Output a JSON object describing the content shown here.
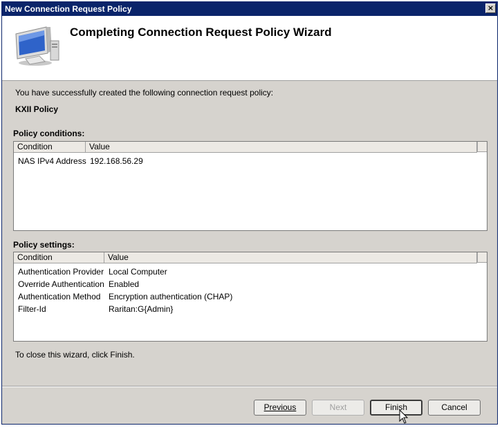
{
  "window": {
    "title": "New Connection Request Policy",
    "close_glyph": "×"
  },
  "header": {
    "title": "Completing Connection Request Policy Wizard",
    "icon": "computer-monitor-icon"
  },
  "intro_text": "You have successfully created the following connection request policy:",
  "policy_name": "KXII Policy",
  "conditions": {
    "label": "Policy conditions:",
    "columns": [
      "Condition",
      "Value"
    ],
    "rows": [
      {
        "condition": "NAS IPv4 Address",
        "value": "192.168.56.29"
      }
    ]
  },
  "settings": {
    "label": "Policy settings:",
    "columns": [
      "Condition",
      "Value"
    ],
    "rows": [
      {
        "condition": "Authentication Provider",
        "value": "Local Computer"
      },
      {
        "condition": "Override Authentication",
        "value": "Enabled"
      },
      {
        "condition": "Authentication Method",
        "value": "Encryption authentication (CHAP)"
      },
      {
        "condition": "Filter-Id",
        "value": "Raritan:G{Admin}"
      }
    ]
  },
  "close_hint": "To close this wizard, click Finish.",
  "buttons": {
    "previous": "Previous",
    "next": "Next",
    "finish": "Finish",
    "cancel": "Cancel"
  },
  "colors": {
    "titlebar": "#0a246a",
    "dialog_bg": "#d6d3ce"
  }
}
